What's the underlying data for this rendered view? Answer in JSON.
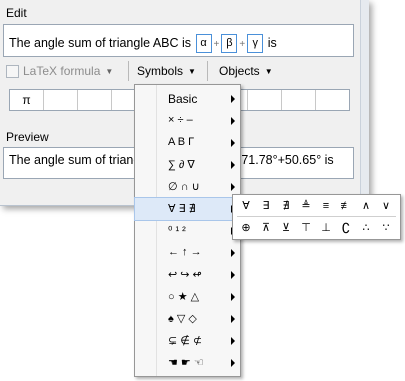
{
  "edit": {
    "label": "Edit",
    "text_prefix": "The angle sum of triangle ABC is",
    "placeholders": [
      "α",
      "β",
      "γ"
    ],
    "plus": "+",
    "text_suffix": "is"
  },
  "toolbar": {
    "latex_label": "LaTeX formula",
    "symbols_label": "Symbols",
    "objects_label": "Objects"
  },
  "symbol_row": [
    "π",
    "",
    "",
    "",
    "",
    "",
    "",
    "",
    "",
    ""
  ],
  "preview": {
    "label": "Preview",
    "text_left": "The angle sum of triang",
    "text_right": "71.78°+50.65° is"
  },
  "symbols_menu": {
    "items": [
      {
        "label": "Basic"
      },
      {
        "label": "× ÷ –"
      },
      {
        "label": "Α Β Γ"
      },
      {
        "label": "∑ ∂ ∇"
      },
      {
        "label": "∅ ∩ ∪"
      },
      {
        "label": "∀ ∃ ∄"
      },
      {
        "label": "⁰ ¹ ²"
      },
      {
        "label": "← ↑ →"
      },
      {
        "label": "↩ ↪ ↫"
      },
      {
        "label": "○ ★ △"
      },
      {
        "label": "♠ ▽ ◇"
      },
      {
        "label": "⊊ ∉ ⊄"
      },
      {
        "label": "☚ ☛ ☜"
      }
    ]
  },
  "logic_submenu": {
    "row1": [
      "∀",
      "∃",
      "∄",
      "≜",
      "≡",
      "≢",
      "∧",
      "∨"
    ],
    "row2": [
      "⊕",
      "⊼",
      "⊻",
      "⊤",
      "⊥",
      "∁",
      "∴",
      "∵"
    ]
  }
}
